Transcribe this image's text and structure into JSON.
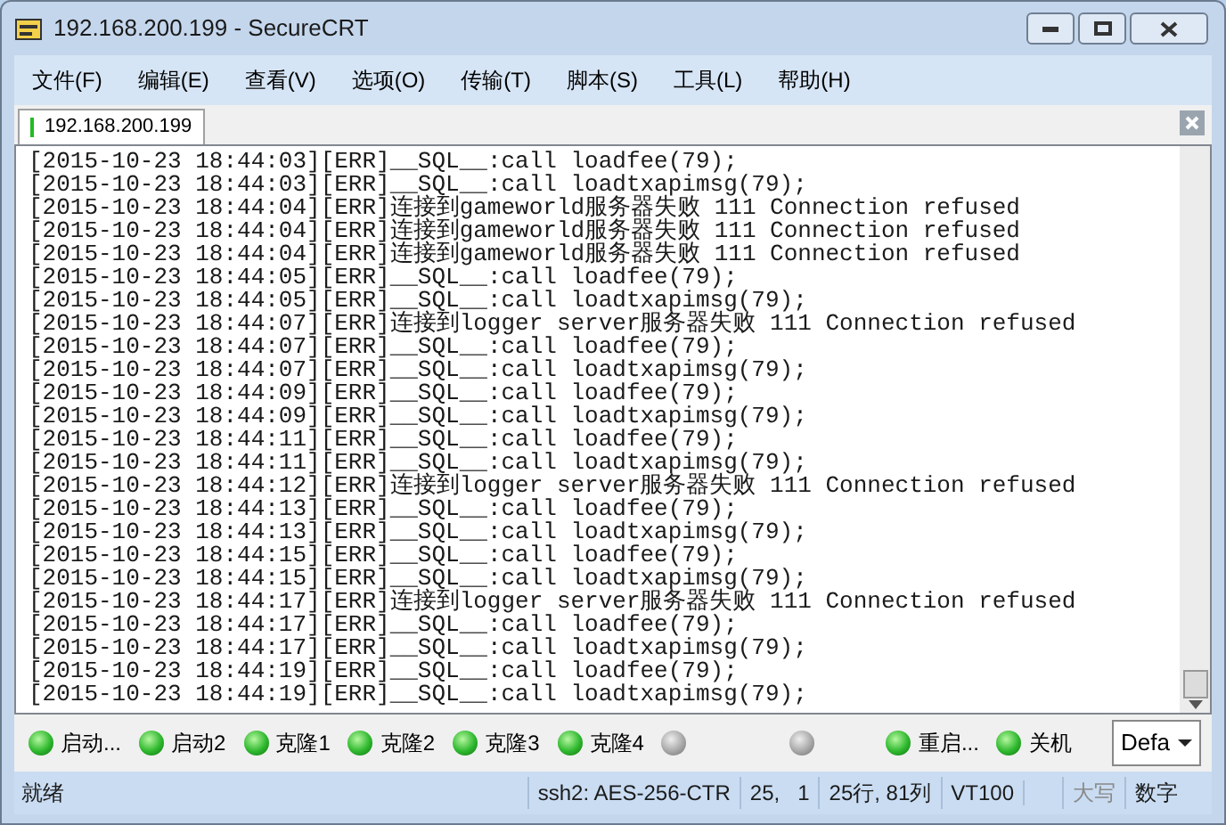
{
  "window": {
    "title": "192.168.200.199 - SecureCRT"
  },
  "menu": [
    "文件(F)",
    "编辑(E)",
    "查看(V)",
    "选项(O)",
    "传输(T)",
    "脚本(S)",
    "工具(L)",
    "帮助(H)"
  ],
  "tabs": [
    {
      "label": "192.168.200.199",
      "selected": true,
      "connected": true
    }
  ],
  "terminal": {
    "lines": [
      "[2015-10-23 18:44:03][ERR]__SQL__:call loadfee(79);",
      "[2015-10-23 18:44:03][ERR]__SQL__:call loadtxapimsg(79);",
      "[2015-10-23 18:44:04][ERR]连接到gameworld服务器失败 111 Connection refused",
      "[2015-10-23 18:44:04][ERR]连接到gameworld服务器失败 111 Connection refused",
      "[2015-10-23 18:44:04][ERR]连接到gameworld服务器失败 111 Connection refused",
      "[2015-10-23 18:44:05][ERR]__SQL__:call loadfee(79);",
      "[2015-10-23 18:44:05][ERR]__SQL__:call loadtxapimsg(79);",
      "[2015-10-23 18:44:07][ERR]连接到logger server服务器失败 111 Connection refused",
      "[2015-10-23 18:44:07][ERR]__SQL__:call loadfee(79);",
      "[2015-10-23 18:44:07][ERR]__SQL__:call loadtxapimsg(79);",
      "[2015-10-23 18:44:09][ERR]__SQL__:call loadfee(79);",
      "[2015-10-23 18:44:09][ERR]__SQL__:call loadtxapimsg(79);",
      "[2015-10-23 18:44:11][ERR]__SQL__:call loadfee(79);",
      "[2015-10-23 18:44:11][ERR]__SQL__:call loadtxapimsg(79);",
      "[2015-10-23 18:44:12][ERR]连接到logger server服务器失败 111 Connection refused",
      "[2015-10-23 18:44:13][ERR]__SQL__:call loadfee(79);",
      "[2015-10-23 18:44:13][ERR]__SQL__:call loadtxapimsg(79);",
      "[2015-10-23 18:44:15][ERR]__SQL__:call loadfee(79);",
      "[2015-10-23 18:44:15][ERR]__SQL__:call loadtxapimsg(79);",
      "[2015-10-23 18:44:17][ERR]连接到logger server服务器失败 111 Connection refused",
      "[2015-10-23 18:44:17][ERR]__SQL__:call loadfee(79);",
      "[2015-10-23 18:44:17][ERR]__SQL__:call loadtxapimsg(79);",
      "[2015-10-23 18:44:19][ERR]__SQL__:call loadfee(79);",
      "[2015-10-23 18:44:19][ERR]__SQL__:call loadtxapimsg(79);"
    ]
  },
  "button_bar": {
    "buttons": [
      {
        "label": "启动...",
        "lit": true
      },
      {
        "label": "启动2",
        "lit": true
      },
      {
        "label": "克隆1",
        "lit": true
      },
      {
        "label": "克隆2",
        "lit": true
      },
      {
        "label": "克隆3",
        "lit": true
      },
      {
        "label": "克隆4",
        "lit": true
      },
      {
        "lit": false
      },
      {
        "lit": false
      },
      {
        "label": "重启...",
        "lit": true
      },
      {
        "label": "关机",
        "lit": true
      }
    ],
    "dropdown": "Defa"
  },
  "status_bar": [
    {
      "text": "就绪",
      "disabled": false
    },
    {
      "text": "ssh2: AES-256-CTR",
      "disabled": false
    },
    {
      "text": "25,   1",
      "disabled": false
    },
    {
      "text": "25行, 81列",
      "disabled": false
    },
    {
      "text": "VT100",
      "disabled": false
    },
    {
      "text": "大写",
      "disabled": true
    },
    {
      "text": "数字",
      "disabled": false
    }
  ]
}
